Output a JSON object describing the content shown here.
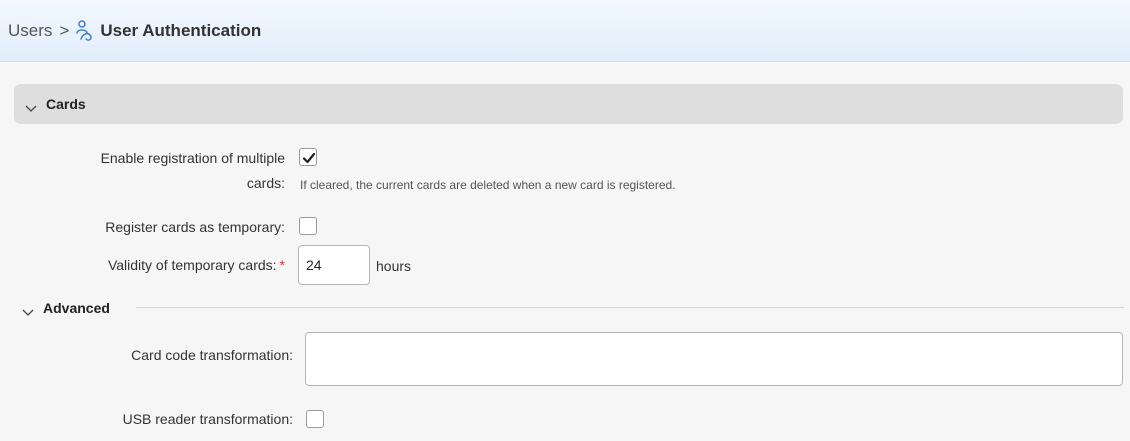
{
  "breadcrumb": {
    "parent": "Users",
    "separator": ">",
    "current": "User Authentication",
    "icon": "user-authentication-icon"
  },
  "cards_section": {
    "title": "Cards",
    "enable_multiple": {
      "label_line1": "Enable registration of multiple",
      "label_line2": "cards:",
      "checked": true,
      "hint": "If cleared, the current cards are deleted when a new card is registered."
    },
    "register_temporary": {
      "label": "Register cards as temporary:",
      "checked": false
    },
    "validity": {
      "label": "Validity of temporary cards:",
      "required_mark": "*",
      "value": "24",
      "unit": "hours"
    }
  },
  "advanced_section": {
    "title": "Advanced",
    "card_code_transformation": {
      "label": "Card code transformation:",
      "value": ""
    },
    "usb_reader_transformation": {
      "label": "USB reader transformation:",
      "checked": false
    }
  },
  "colors": {
    "header_gradient_top": "#f3f8fe",
    "header_gradient_bottom": "#e1eefb",
    "icon_blue": "#3d7cc9",
    "required": "#d33333"
  }
}
